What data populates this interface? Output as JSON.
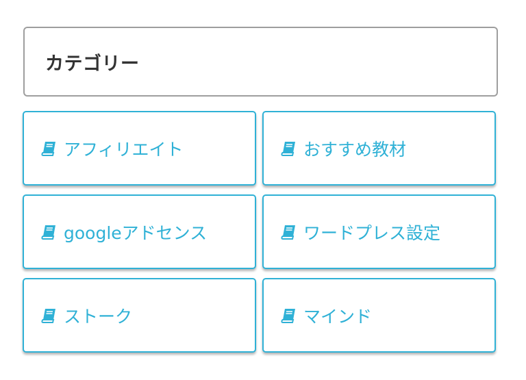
{
  "widget": {
    "title": "カテゴリー"
  },
  "categories": [
    {
      "label": "アフィリエイト",
      "icon": "book-icon"
    },
    {
      "label": "おすすめ教材",
      "icon": "book-icon"
    },
    {
      "label": "googleアドセンス",
      "icon": "book-icon"
    },
    {
      "label": "ワードプレス設定",
      "icon": "book-icon"
    },
    {
      "label": "ストーク",
      "icon": "book-icon"
    },
    {
      "label": "マインド",
      "icon": "book-icon"
    }
  ],
  "colors": {
    "accent": "#2fb1d6",
    "title_text": "#333333",
    "header_border": "#9e9e9e"
  }
}
